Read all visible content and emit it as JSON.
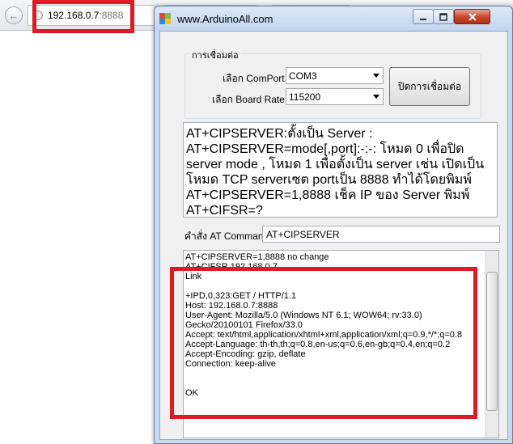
{
  "browser": {
    "url_host": "192.168.0.7",
    "url_port": ":8888"
  },
  "window": {
    "title": "www.ArduinoAll.com",
    "minimize_icon": "minimize-icon",
    "maximize_icon": "maximize-icon",
    "close_icon": "close-icon"
  },
  "connection": {
    "group_title": "การเชื่อมต่อ",
    "comport_label": "เลือก ComPort",
    "comport_value": "COM3",
    "baud_label": "เลือก Board Rate",
    "baud_value": "115200",
    "disconnect_label": "ปิดการเชื่อมต่อ"
  },
  "help_text": "AT+CIPSERVER:ตั้งเป็น Server : AT+CIPSERVER=mode[,port]:-:-: โหมด 0 เพื่อปิด server mode , โหมด 1 เพื่อตั้งเป็น server เช่น เปิดเป็นโหมด TCP serverเซต portเป็น 8888 ทำได้โดยพิมพ์ AT+CIPSERVER=1,8888 เช็ค IP ของ Server พิมพ์ AT+CIFSR=?",
  "command": {
    "label": "คำสั่ง AT Command",
    "value": "AT+CIPSERVER"
  },
  "log": {
    "lines": [
      "AT+CIPSERVER=1,8888 no change",
      "AT+CIFSR 192.168.0.7",
      "Link",
      "",
      "+IPD,0,323:GET / HTTP/1.1",
      "Host: 192.168.0.7:8888",
      "User-Agent: Mozilla/5.0 (Windows NT 6.1; WOW64; rv:33.0)",
      "Gecko/20100101 Firefox/33.0",
      "Accept: text/html,application/xhtml+xml,application/xml;q=0.9,*/*;q=0.8",
      "Accept-Language: th-th,th;q=0.8,en-us;q=0.6,en-gb;q=0.4,en;q=0.2",
      "Accept-Encoding: gzip, deflate",
      "Connection: keep-alive",
      "",
      "",
      "OK"
    ]
  },
  "colors": {
    "highlight": "#e01a22"
  }
}
